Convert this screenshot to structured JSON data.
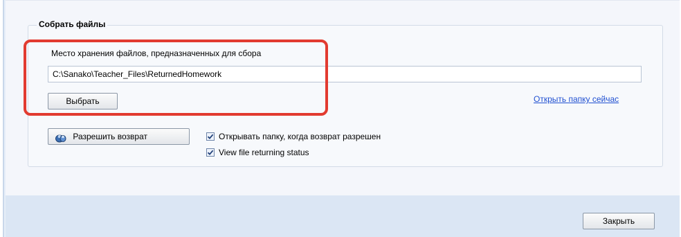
{
  "group": {
    "title": "Собрать файлы",
    "storage_label": "Место хранения файлов, предназначенных для сбора",
    "path_value": "C:\\Sanako\\Teacher_Files\\ReturnedHomework",
    "browse_label": "Выбрать",
    "open_folder_link": "Открыть папку сейчас",
    "allow_return_label": "Разрешить возврат",
    "checkboxes": [
      {
        "label": "Открывать папку, когда возврат разрешен",
        "checked": true
      },
      {
        "label": "View file returning status",
        "checked": true
      }
    ]
  },
  "footer": {
    "close_label": "Закрыть"
  },
  "colors": {
    "highlight": "#e23b30",
    "link": "#1f4fd1",
    "footer_bg": "#dbe6f4"
  },
  "icons": {
    "allow_return": "return-people-icon",
    "checkbox": "check-icon"
  }
}
